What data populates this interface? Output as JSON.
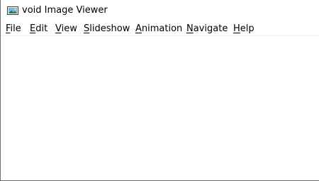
{
  "window": {
    "title": "void Image Viewer",
    "icon": "image-viewer-app-icon"
  },
  "menubar": {
    "items": [
      {
        "mnemonic": "F",
        "rest": "ile"
      },
      {
        "mnemonic": "E",
        "rest": "dit"
      },
      {
        "mnemonic": "V",
        "rest": "iew"
      },
      {
        "mnemonic": "S",
        "rest": "lideshow"
      },
      {
        "mnemonic": "A",
        "rest": "nimation"
      },
      {
        "mnemonic": "N",
        "rest": "avigate"
      },
      {
        "mnemonic": "H",
        "rest": "elp"
      }
    ]
  }
}
